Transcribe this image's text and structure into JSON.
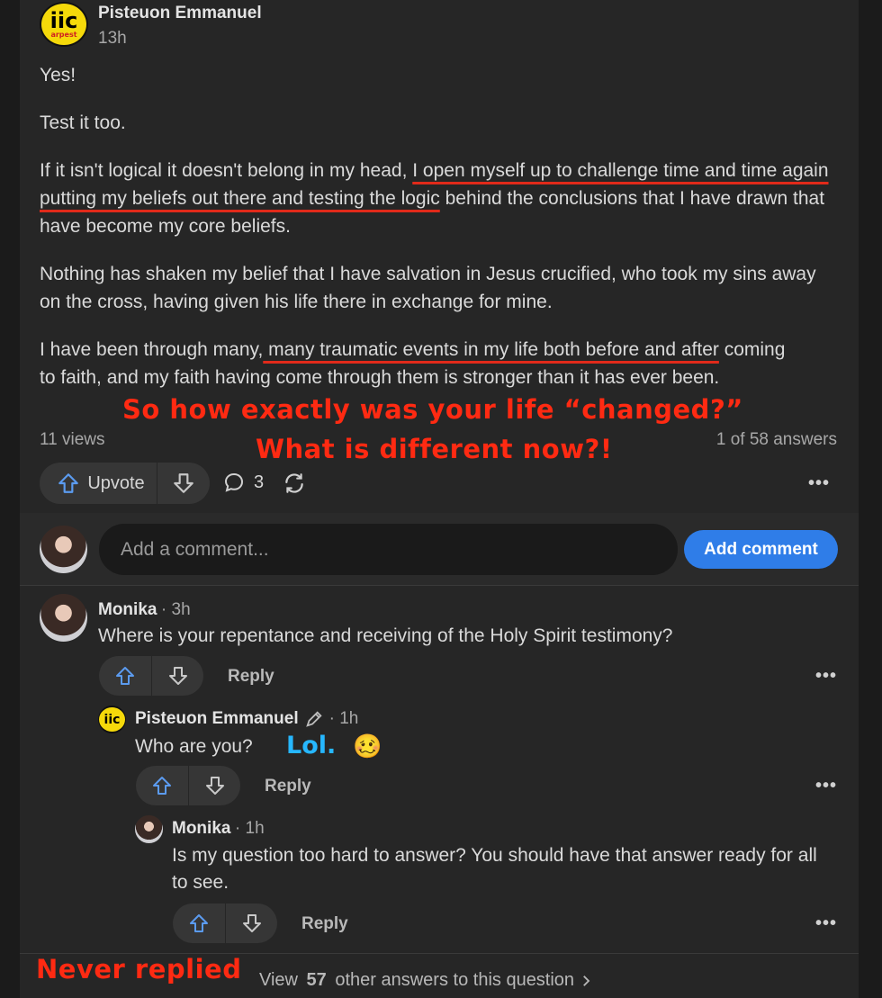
{
  "post": {
    "author": "Pisteuon Emmanuel",
    "avatar_text": "iic",
    "avatar_subtext": "arpest",
    "time": "13h",
    "paragraphs": {
      "p1": "Yes!",
      "p2": "Test it too.",
      "p3a": "If it isn't logical it doesn't belong in my head, ",
      "p3b": "I open myself up to challenge time and time again putting my beliefs out there and testing the logic",
      "p3c": " behind the conclusions that I have drawn that have become my core beliefs.",
      "p4": "Nothing has shaken my belief that I have salvation in Jesus crucified, who took my sins away on the cross, having given his life there in exchange for mine.",
      "p5a": "I have been through many,",
      "p5b": " many traumatic events in my life both before and after",
      "p5c": " coming to faith, and my faith having come through them is stronger than it has ever been."
    },
    "views": "11 views",
    "answer_position": "1 of 58 answers",
    "upvote_label": "Upvote",
    "comment_count": "3"
  },
  "annotations": {
    "red_line1": "So how exactly was your life “changed?”",
    "red_line2": "What is different now?!",
    "blue_lol": "Lol.",
    "emoji": "🥴",
    "never_replied": "Never replied"
  },
  "comment_box": {
    "placeholder": "Add a comment...",
    "button_label": "Add comment"
  },
  "comments": [
    {
      "author": "Monika",
      "time": "· 3h",
      "text": "Where is your repentance and receiving of the Holy Spirit testimony?",
      "reply_label": "Reply"
    },
    {
      "author": "Pisteuon Emmanuel",
      "time": "· 1h",
      "text": "Who are you?",
      "reply_label": "Reply"
    },
    {
      "author": "Monika",
      "time": "· 1h",
      "text": "Is my question too hard to answer? You should have that answer ready for all to see.",
      "reply_label": "Reply"
    }
  ],
  "footer": {
    "prefix": "View ",
    "count": "57",
    "suffix": " other answers to this question"
  },
  "colors": {
    "accent": "#2f7de8",
    "annotation_red": "#ff2a12",
    "annotation_blue": "#26b7ff"
  }
}
